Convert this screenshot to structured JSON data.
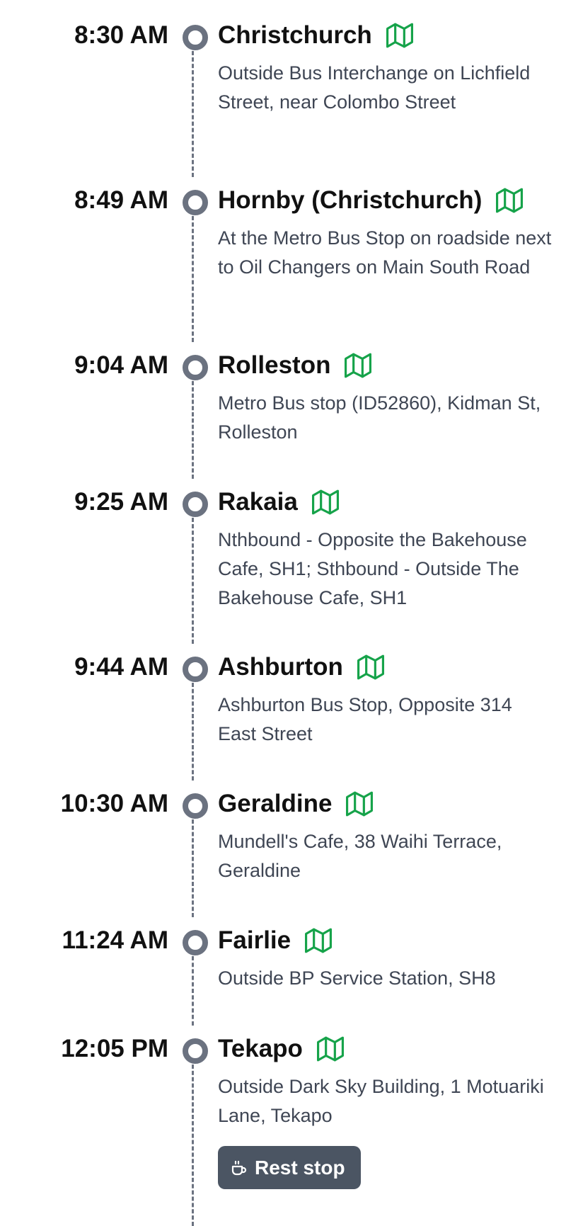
{
  "stops": [
    {
      "time": "8:30 AM",
      "name": "Christchurch",
      "address": "Outside Bus Interchange on Lichfield Street, near Colombo Street",
      "icon": "map-icon"
    },
    {
      "time": "8:49 AM",
      "name": "Hornby (Christchurch)",
      "address": "At the Metro Bus Stop on roadside next to Oil Changers on Main South Road",
      "icon": "map-icon"
    },
    {
      "time": "9:04 AM",
      "name": "Rolleston",
      "address": "Metro Bus stop (ID52860), Kidman St, Rolleston",
      "icon": "map-icon"
    },
    {
      "time": "9:25 AM",
      "name": "Rakaia",
      "address": "Nthbound - Opposite the Bakehouse Cafe, SH1; Sthbound - Outside The Bakehouse Cafe, SH1",
      "icon": "map-icon"
    },
    {
      "time": "9:44 AM",
      "name": "Ashburton",
      "address": "Ashburton Bus Stop, Opposite 314 East Street",
      "icon": "map-icon"
    },
    {
      "time": "10:30 AM",
      "name": "Geraldine",
      "address": "Mundell's Cafe, 38 Waihi Terrace, Geraldine",
      "icon": "map-icon"
    },
    {
      "time": "11:24 AM",
      "name": "Fairlie",
      "address": "Outside BP Service Station, SH8",
      "icon": "map-icon"
    },
    {
      "time": "12:05 PM",
      "name": "Tekapo",
      "address": "Outside Dark Sky Building, 1 Motuariki Lane, Tekapo",
      "icon": "map-icon"
    }
  ],
  "rest_stop": {
    "label": "Rest stop",
    "icon": "coffee-cup-icon"
  },
  "colors": {
    "map_icon": "#16a34a",
    "timeline": "#6b7280",
    "rest_button_bg": "#4b5563",
    "address_text": "#3f4654",
    "heading_text": "#111111"
  }
}
